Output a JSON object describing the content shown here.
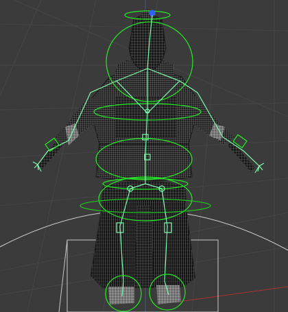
{
  "viewport": {
    "background": "#3b3b3b",
    "grid_color": "#454545",
    "axis_x_color": "#b03030",
    "axis_y_color": "#2f8a9e",
    "axis_z_color": "#4a7ab0",
    "mesh_color": "#cfcfcf",
    "mesh_dark": "#161616",
    "rig_color": "#22ee22",
    "rig_joint_color": "#7fffb0",
    "selection_color": "#2f62ff",
    "ground_rect_color": "#c9c9c9",
    "ground_circle_color": "#d0d0d0"
  },
  "scene": {
    "object_type": "character-mesh",
    "view_mode": "wireframe-with-rig",
    "rig_controls": [
      "head-control",
      "neck-control",
      "chest-control",
      "hip-control",
      "pelvis-control",
      "hand-control-left",
      "hand-control-right",
      "foot-control-left",
      "foot-control-right",
      "root-control"
    ]
  }
}
